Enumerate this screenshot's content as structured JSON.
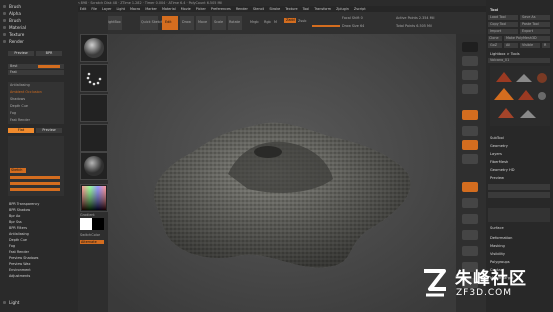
{
  "left_menu": [
    "Brush",
    "Alpha",
    "Brush",
    "Material",
    "Texture",
    "Render"
  ],
  "render_tabs": {
    "a": "Preview",
    "b": "BPR"
  },
  "render_rows": [
    "Best",
    "Fast"
  ],
  "render_options": [
    "Antialiasing",
    "Ambient Occlusion",
    "Shadows",
    "Depth Cue",
    "Fog",
    "Fast Render",
    "Flat",
    "Preview",
    "Sketch"
  ],
  "render_list": [
    "BPR Transparency",
    "BPR Shadow",
    "Bpr Ao",
    "Bpr Sss",
    "BPR Filters",
    "Antialiasing",
    "Depth Cue",
    "Fog",
    "Fast Render",
    "Preview Shadows",
    "Preview Wax",
    "Environment",
    "Adjustments"
  ],
  "bottom_left": "Light",
  "shelf_buttons": [
    "Projection Master",
    "LightBox",
    "Quick Sketch",
    "Edit",
    "Draw",
    "Move",
    "Scale",
    "Rotate",
    "Mrgb",
    "Rgb",
    "M",
    "Zadd",
    "Zsub",
    "Focal Shift 0",
    "Draw Size 64",
    "Active Points 2.354 Mil",
    "Total Points 6.505 Mil"
  ],
  "thumb_labels": [
    "Gradient",
    "SwitchColor",
    "Alternate"
  ],
  "right_panel": {
    "title": "Tool",
    "buttons": [
      "Load Tool",
      "Save As",
      "Copy Tool",
      "Paste Tool",
      "Import",
      "Export",
      "Clone",
      "Make PolyMesh3D",
      "GoZ",
      "All",
      "Visible",
      "R"
    ],
    "sections": [
      "Lightbox > Tools",
      "SubTool",
      "Geometry",
      "Layers",
      "FiberMesh",
      "Geometry HD",
      "Preview",
      "Surface",
      "Deformation",
      "Masking",
      "Visibility",
      "Polygroups",
      "Contact",
      "Morph Target"
    ],
    "tool_label": "Volcano_01"
  },
  "watermark": {
    "text": "朱峰社区",
    "url": "ZF3D.COM"
  },
  "colors": {
    "accent": "#f08a2c",
    "panel": "#2a2a2a",
    "viewport": "#4a4a4a"
  }
}
